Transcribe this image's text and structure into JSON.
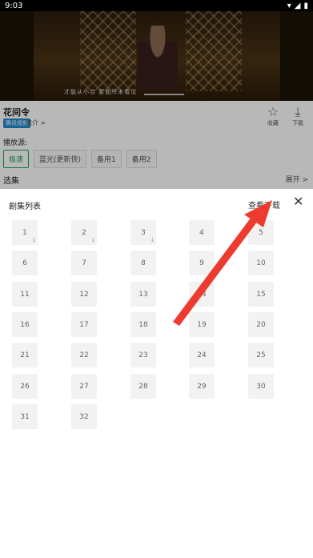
{
  "status": {
    "time": "9:03"
  },
  "video": {
    "subtitle": "才能从小合  蒙面所未看见"
  },
  "info": {
    "title": "花间令",
    "badge": "腾讯视频",
    "intro": "简介 >",
    "favorite_label": "收藏",
    "download_label": "下载",
    "source_label": "播放源:",
    "sources": [
      "极速",
      "蓝光(更新快)",
      "备用1",
      "备用2"
    ],
    "episodes_label": "选集",
    "expand_label": "展开 >"
  },
  "panel": {
    "title": "剧集列表",
    "view_downloads": "查看下载",
    "close_symbol": "✕",
    "episodes": [
      "1",
      "2",
      "3",
      "4",
      "5",
      "6",
      "7",
      "8",
      "9",
      "10",
      "11",
      "12",
      "13",
      "14",
      "15",
      "16",
      "17",
      "18",
      "19",
      "20",
      "21",
      "22",
      "23",
      "24",
      "25",
      "26",
      "27",
      "28",
      "29",
      "30",
      "31",
      "32"
    ],
    "downloaded": [
      "1",
      "2",
      "3"
    ]
  },
  "icons": {
    "favorite": "star-outline-icon",
    "download": "download-icon",
    "close": "close-icon"
  },
  "colors": {
    "accent_green": "#1b9e5b",
    "arrow_red": "#ee3b2f",
    "badge_blue": "#1f8bd0"
  }
}
